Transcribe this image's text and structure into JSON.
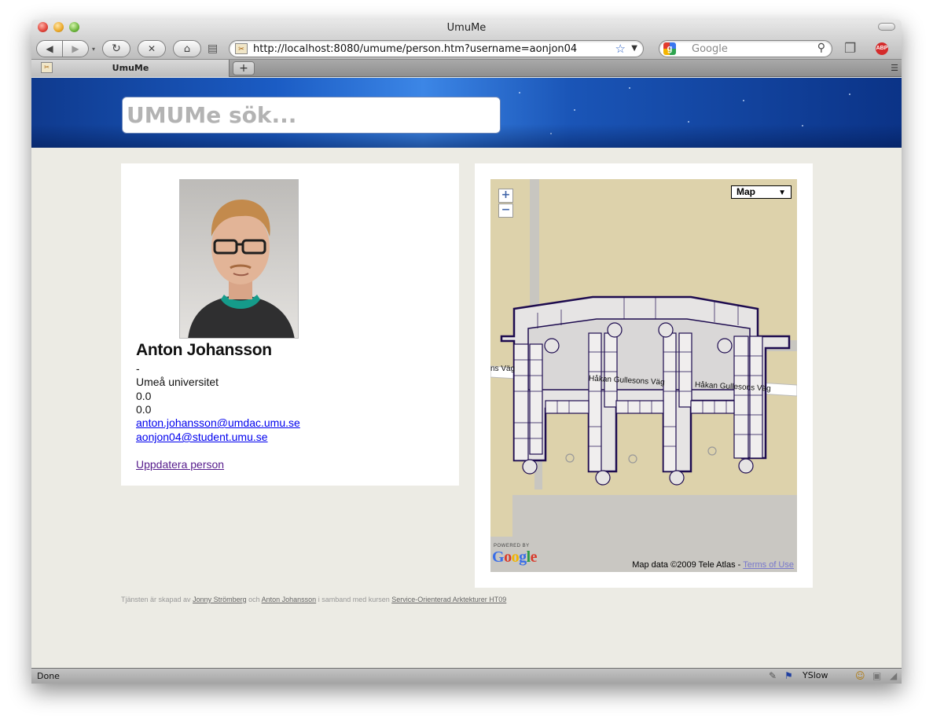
{
  "browser": {
    "window_title": "UmuMe",
    "url": "http://localhost:8080/umume/person.htm?username=aonjon04",
    "search_placeholder": "Google",
    "tab_label": "UmuMe",
    "new_tab": "+",
    "status": "Done",
    "yslow_label": "YSlow"
  },
  "site": {
    "search_placeholder": "UMUMe sök..."
  },
  "person": {
    "name": "Anton Johansson",
    "dash": "-",
    "organization": "Umeå universitet",
    "value1": "0.0",
    "value2": "0.0",
    "email1": "anton.johansson@umdac.umu.se",
    "email2": "aonjon04@student.umu.se",
    "update_link": "Uppdatera person"
  },
  "map": {
    "type_label": "Map",
    "zoom_in": "+",
    "zoom_out": "−",
    "powered_by": "POWERED BY",
    "logo": "Google",
    "attribution": "Map data ©2009 Tele Atlas - ",
    "terms_link": "Terms of Use",
    "road_label": "Håkan Gullesons Väg",
    "road_label_cut": "ns Väg"
  },
  "footer": {
    "prefix": "Tjänsten är skapad av ",
    "author1": "Jonny Strömberg",
    "and": " och ",
    "author2": "Anton Johansson",
    "middle": " i samband med kursen ",
    "course": "Service-Orienterad Arktekturer HT09"
  },
  "icons": {
    "back": "back-arrow-icon",
    "forward": "forward-arrow-icon",
    "reload": "reload-icon",
    "stop": "stop-icon",
    "home": "home-icon"
  }
}
